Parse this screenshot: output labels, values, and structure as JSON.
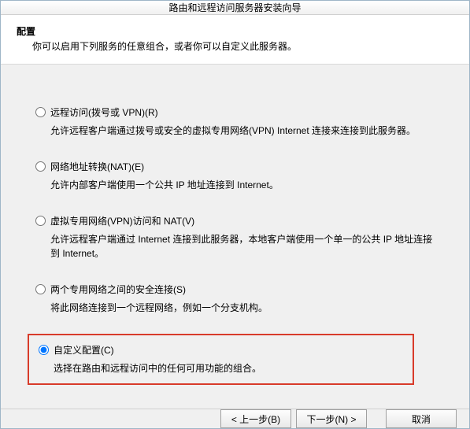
{
  "window": {
    "title": "路由和远程访问服务器安装向导"
  },
  "header": {
    "title": "配置",
    "subtitle": "你可以启用下列服务的任意组合，或者你可以自定义此服务器。"
  },
  "options": [
    {
      "id": "remote-access",
      "label": "远程访问(拨号或 VPN)(R)",
      "desc": "允许远程客户端通过拨号或安全的虚拟专用网络(VPN) Internet 连接来连接到此服务器。",
      "selected": false,
      "highlighted": false
    },
    {
      "id": "nat",
      "label": "网络地址转换(NAT)(E)",
      "desc": "允许内部客户端使用一个公共 IP 地址连接到 Internet。",
      "selected": false,
      "highlighted": false
    },
    {
      "id": "vpn-nat",
      "label": "虚拟专用网络(VPN)访问和 NAT(V)",
      "desc": "允许远程客户端通过 Internet 连接到此服务器，本地客户端使用一个单一的公共 IP 地址连接到 Internet。",
      "selected": false,
      "highlighted": false
    },
    {
      "id": "secure-two-net",
      "label": "两个专用网络之间的安全连接(S)",
      "desc": "将此网络连接到一个远程网络，例如一个分支机构。",
      "selected": false,
      "highlighted": false
    },
    {
      "id": "custom",
      "label": "自定义配置(C)",
      "desc": "选择在路由和远程访问中的任何可用功能的组合。",
      "selected": true,
      "highlighted": true
    }
  ],
  "footer": {
    "back": "< 上一步(B)",
    "next": "下一步(N) >",
    "cancel": "取消"
  }
}
